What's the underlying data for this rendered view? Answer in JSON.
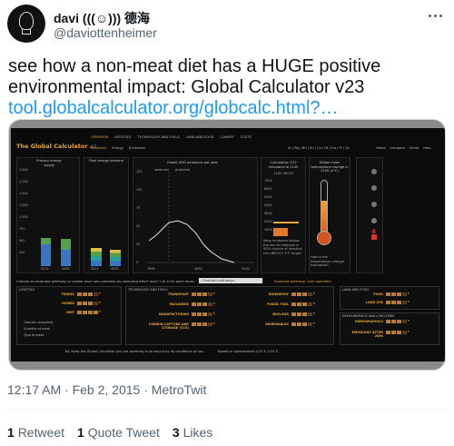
{
  "author": {
    "display_name": "davi (((☺))) 德海",
    "handle": "@daviottenheimer"
  },
  "tweet": {
    "text": "see how a non-meat diet has a HUGE positive environmental impact: Global Calculator v23",
    "link": "tool.globalcalculator.org/globcalc.html?…"
  },
  "media": {
    "app_title": "The Global Calculator",
    "app_version": "v23",
    "top_nav": [
      "OVERVIEW",
      "LIFESTYLE",
      "TECHNOLOGY AND FUELS",
      "LAND AND FOOD",
      "CLIMATE",
      "COSTS"
    ],
    "sub_nav": [
      "Summary",
      "Energy",
      "Emissions"
    ],
    "languages": "Ar  |  Bg  |  Brl  |  En  |  Cn  |  Ht  |  Hu  |  Pl  |  Sp",
    "right_nav": [
      "Home",
      "Compare",
      "Share",
      "Help"
    ],
    "panels": {
      "primary_energy": "Primary energy supply",
      "final_energy": "Final energy demand",
      "ghg": "Global GHG emissions per year",
      "cumulative": "Cumulative CO2 emissions to 2100",
      "cumulative_value": "1182 GtCO2",
      "temperature": "Global mean temperature change in 2100 (x°C)",
      "keep_note": "Keep emissions below the line to maintain a 50% chance of meeting the UNFCCC 2°C target",
      "temp_note": "How is the temperature change estimated?"
    },
    "energy_ticks": [
      "2,000",
      "1,750",
      "1,500",
      "1,250",
      "1,000",
      "750",
      "500",
      "250"
    ],
    "years_left": [
      "2011",
      "2050"
    ],
    "years_ghg": [
      "1990",
      "2050",
      "2100"
    ],
    "ghg_ticks": [
      "125",
      "100",
      "75",
      "50",
      "25",
      "0"
    ],
    "ghg_legend": [
      "observed",
      "projected"
    ],
    "cumulative_ticks": [
      "7000",
      "6000",
      "5000",
      "4000",
      "3000",
      "2000",
      "1000"
    ],
    "temp_value": "4",
    "controls_text": "Choose an example pathway or create your own pathway by selecting effort level 1 to 4 for each lever:",
    "dropdown_value": "--Example pathways--",
    "selected_pathway": "Selected pathway: user specified",
    "lever_groups": [
      {
        "title": "LIFESTYLE",
        "levers": [
          "TRAVEL",
          "HOMES",
          "DIET"
        ],
        "extra": [
          "Calories consumed",
          "Quantity of meat",
          "Type of meat"
        ]
      },
      {
        "title": "TECHNOLOGY AND FUELS",
        "levers": [
          "TRANSPORT",
          "BUILDINGS",
          "MANUFACTURING",
          "CARBON CAPTURE AND STORAGE (CCS)"
        ]
      },
      {
        "title": "",
        "levers": [
          "BIOENERGY",
          "FOSSIL FUEL",
          "NUCLEAR",
          "RENEWABLES"
        ]
      },
      {
        "title": "LAND AND FOOD",
        "levers": [
          "FOOD",
          "LAND USE"
        ]
      },
      {
        "title": "DEMOGRAPHICS AND LONG-TERM",
        "levers": [
          "DEMOGRAPHICS",
          "EMISSIONS AFTER 2050"
        ]
      }
    ],
    "footer_text": "By using the Global Calculator you are agreeing to be bound by its conditions of use.",
    "footer_right": "Based on spreadsheet v.23 © v.23 ©",
    "colors": {
      "accent": "#e8a33a",
      "blue": "#3a74c4",
      "green": "#55a04a",
      "teal": "#2aa0a0",
      "yellow": "#e0c040"
    }
  },
  "meta": {
    "timestamp": "12:17 AM · Feb 2, 2015 · MetroTwit",
    "retweets_count": "1",
    "retweets_label": "Retweet",
    "quotes_count": "1",
    "quotes_label": "Quote Tweet",
    "likes_count": "3",
    "likes_label": "Likes"
  }
}
